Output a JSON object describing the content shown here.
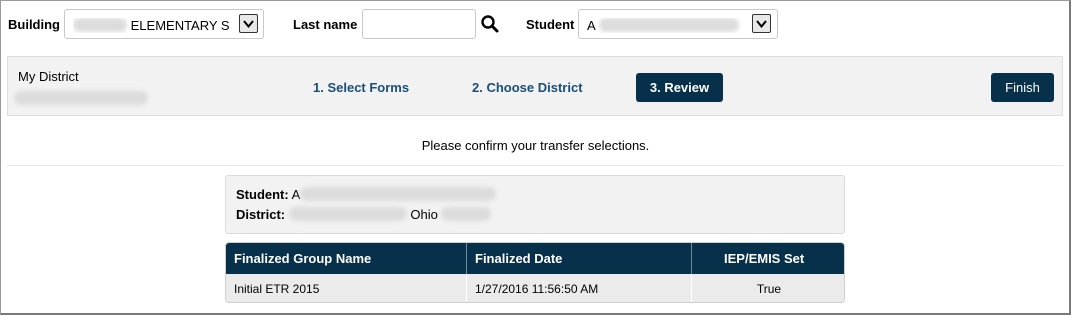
{
  "filters": {
    "building_label": "Building",
    "building_value": "ELEMENTARY S",
    "lastname_label": "Last name",
    "lastname_value": "",
    "student_label": "Student",
    "student_value": "A"
  },
  "wizard": {
    "district_label": "My District",
    "steps": [
      {
        "label": "1. Select Forms"
      },
      {
        "label": "2. Choose District"
      },
      {
        "label": "3. Review"
      }
    ],
    "finish_label": "Finish"
  },
  "confirm_message": "Please confirm your transfer selections.",
  "summary": {
    "student_label": "Student:",
    "student_value": "A",
    "district_label": "District:",
    "district_state": "Ohio"
  },
  "table": {
    "columns": [
      "Finalized Group Name",
      "Finalized Date",
      "IEP/EMIS Set"
    ],
    "rows": [
      [
        "Initial ETR 2015",
        "1/27/2016 11:56:50 AM",
        "True"
      ]
    ]
  },
  "colors": {
    "accent": "#07304a",
    "link": "#1a4f7a",
    "panel": "#f2f2f2"
  }
}
